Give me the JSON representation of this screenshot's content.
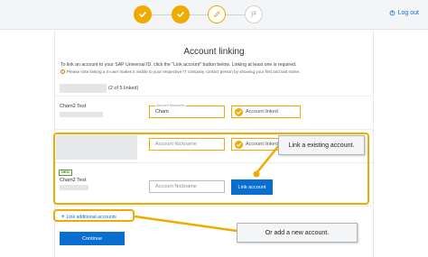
{
  "topbar": {
    "steps": [
      {
        "state": "done",
        "icon": "check-icon"
      },
      {
        "state": "done",
        "icon": "check-icon"
      },
      {
        "state": "current",
        "icon": "pen-icon"
      },
      {
        "state": "future",
        "icon": "flag-icon"
      }
    ],
    "logout_label": "Log out"
  },
  "main": {
    "title": "Account linking",
    "description": "To link an account to your SAP Universal ID, click the \"Link account\" button below. Linking at least one is required.",
    "note": "Please note linking a S-user makes it visible to your respective IT company contact person by showing your first and last name.",
    "linked_count": "(2 of 5 linked)"
  },
  "accounts": [
    {
      "name": "Cham2 Test",
      "nickname_label": "Account Nickname",
      "nickname_value": "Cham",
      "status": "Account linked"
    },
    {
      "name": "",
      "nickname_placeholder": "Account Nickname",
      "status": "Account linked"
    },
    {
      "badge": "NEW",
      "name": "Cham2 Test",
      "nickname_placeholder": "Account Nickname",
      "button": "Link account"
    }
  ],
  "add_link": "Link additional accounts",
  "continue_label": "Continue",
  "callouts": {
    "existing": "Link a existing account.",
    "new": "Or add a new account."
  },
  "colors": {
    "accent": "#f0ab00",
    "primary": "#0a6ed1"
  }
}
